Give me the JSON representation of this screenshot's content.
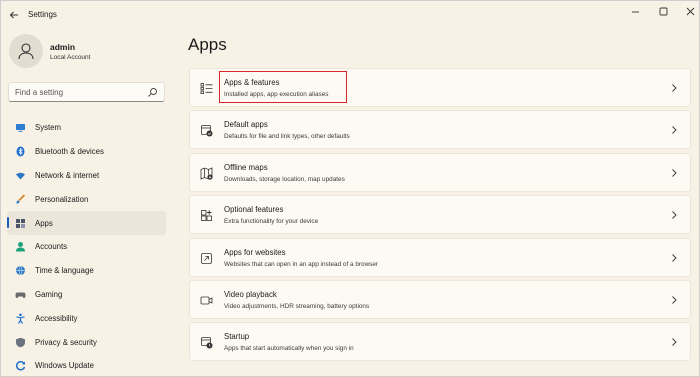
{
  "window": {
    "title": "Settings"
  },
  "user": {
    "name": "admin",
    "account_type": "Local Account"
  },
  "search": {
    "placeholder": "Find a setting"
  },
  "sidebar": {
    "items": [
      {
        "label": "System",
        "icon": "monitor-icon",
        "color": "#2d7dd2"
      },
      {
        "label": "Bluetooth & devices",
        "icon": "bluetooth-icon",
        "color": "#1f6fd1"
      },
      {
        "label": "Network & internet",
        "icon": "wifi-icon",
        "color": "#2b78c5"
      },
      {
        "label": "Personalization",
        "icon": "brush-icon",
        "color": "#d9822b"
      },
      {
        "label": "Apps",
        "icon": "apps-icon",
        "color": "#4a5568",
        "active": true
      },
      {
        "label": "Accounts",
        "icon": "person-icon",
        "color": "#1ca37c"
      },
      {
        "label": "Time & language",
        "icon": "globe-icon",
        "color": "#2b78c5"
      },
      {
        "label": "Gaming",
        "icon": "controller-icon",
        "color": "#6b6b6b"
      },
      {
        "label": "Accessibility",
        "icon": "accessibility-icon",
        "color": "#1f6fd1"
      },
      {
        "label": "Privacy & security",
        "icon": "shield-icon",
        "color": "#6b7280"
      },
      {
        "label": "Windows Update",
        "icon": "update-icon",
        "color": "#1f6fd1"
      }
    ]
  },
  "main": {
    "title": "Apps",
    "cards": [
      {
        "title": "Apps & features",
        "subtitle": "Installed apps, app execution aliases",
        "icon": "list-icon",
        "highlighted": true
      },
      {
        "title": "Default apps",
        "subtitle": "Defaults for file and link types, other defaults",
        "icon": "default-apps-icon"
      },
      {
        "title": "Offline maps",
        "subtitle": "Downloads, storage location, map updates",
        "icon": "map-icon"
      },
      {
        "title": "Optional features",
        "subtitle": "Extra functionality for your device",
        "icon": "grid-plus-icon"
      },
      {
        "title": "Apps for websites",
        "subtitle": "Websites that can open in an app instead of a browser",
        "icon": "link-box-icon"
      },
      {
        "title": "Video playback",
        "subtitle": "Video adjustments, HDR streaming, battery options",
        "icon": "video-icon"
      },
      {
        "title": "Startup",
        "subtitle": "Apps that start automatically when you sign in",
        "icon": "startup-icon"
      }
    ]
  },
  "colors": {
    "accent": "#1b5eb8",
    "highlight": "#d9262b",
    "background": "#f8f2e6"
  }
}
